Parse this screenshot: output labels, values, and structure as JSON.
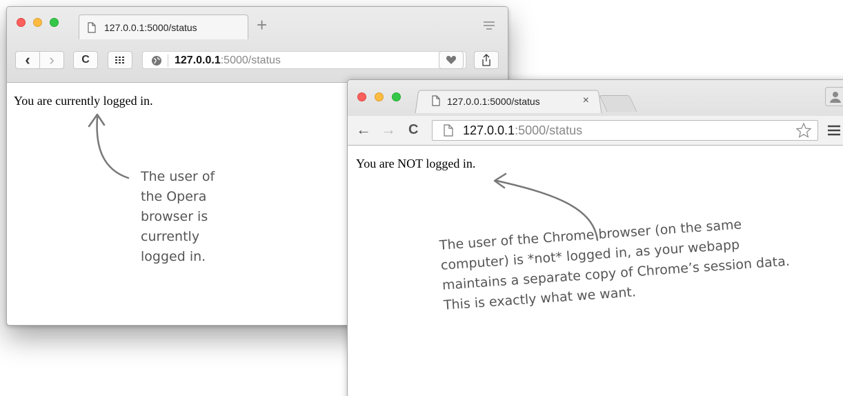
{
  "opera_window": {
    "tab_title": "127.0.0.1:5000/status",
    "new_tab_label": "+",
    "url_host": "127.0.0.1",
    "url_path": ":5000/status",
    "back_label": "‹",
    "forward_label": "›",
    "reload_label": "C",
    "page_text": "You are currently logged in."
  },
  "chrome_window": {
    "tab_title": "127.0.0.1:5000/status",
    "tab_close": "×",
    "back_label": "←",
    "forward_label": "→",
    "reload_label": "C",
    "url_host": "127.0.0.1",
    "url_path": ":5000/status",
    "page_text": "You are NOT logged in."
  },
  "annotations": {
    "opera_note": "The user of\nthe Opera\nbrowser is\ncurrently\nlogged in.",
    "chrome_note": "The user of the Chrome browser (on the same\ncomputer) is *not* logged in, as your webapp\nmaintains a separate copy of Chrome’s session data.\nThis is exactly what we want."
  },
  "colors": {
    "traffic_red": "#fc605c",
    "traffic_yellow": "#fdbc40",
    "traffic_green": "#34c84a",
    "annotation_gray": "#555555"
  },
  "icons": [
    "doc-icon",
    "globe-icon",
    "speed-dial-icon",
    "heart-icon",
    "share-icon",
    "menu-icon",
    "star-icon",
    "profile-icon",
    "hamburger-icon"
  ]
}
